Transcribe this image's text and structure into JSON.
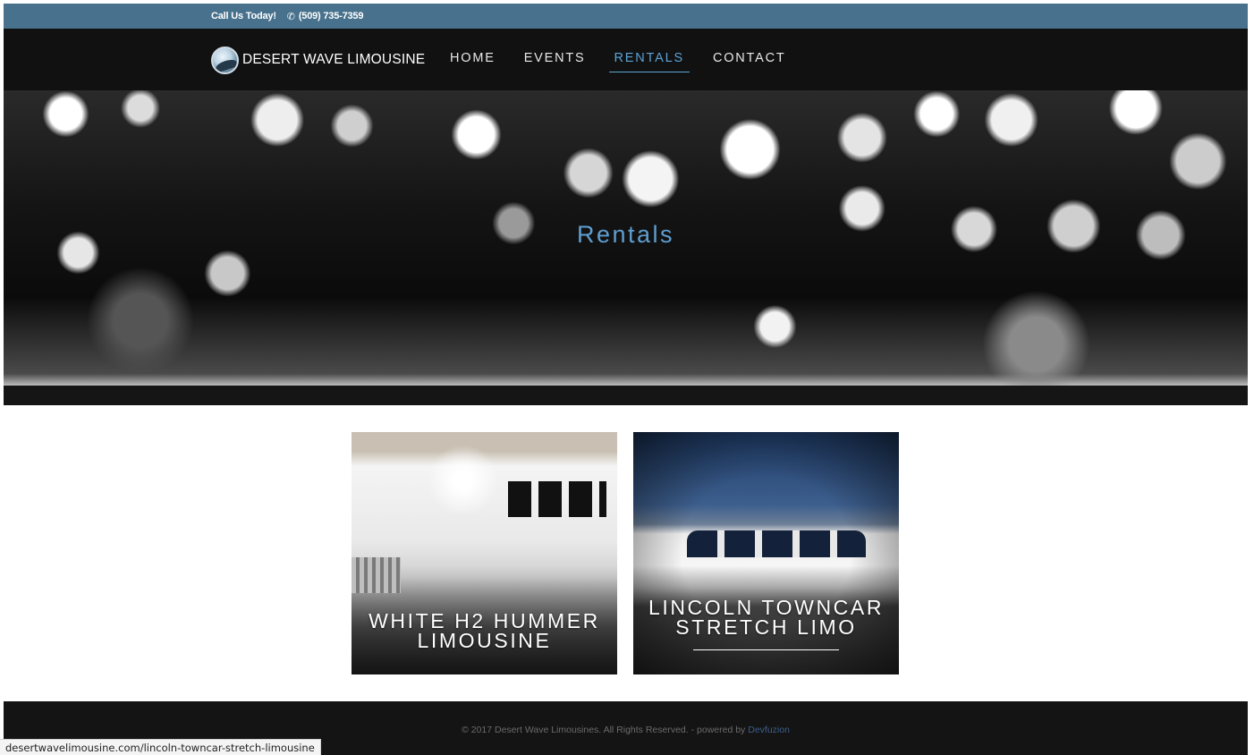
{
  "topbar": {
    "call_label": "Call Us Today!",
    "phone_icon": "✆",
    "phone": "(509) 735-7359"
  },
  "brand": {
    "name": "DESERT WAVE LIMOUSINE"
  },
  "nav": {
    "items": [
      {
        "label": "HOME"
      },
      {
        "label": "EVENTS"
      },
      {
        "label": "RENTALS"
      },
      {
        "label": "CONTACT"
      }
    ],
    "active": "RENTALS"
  },
  "hero": {
    "title": "Rentals"
  },
  "cards": [
    {
      "title": "WHITE H2 HUMMER LIMOUSINE"
    },
    {
      "title": "LINCOLN TOWNCAR STRETCH LIMO"
    }
  ],
  "footer": {
    "text": "© 2017 Desert Wave Limousines. All Rights Reserved. - powered by ",
    "link": "Devfuzion"
  },
  "statusbar": {
    "url": "desertwavelimousine.com/lincoln-towncar-stretch-limousine"
  },
  "colors": {
    "topbar": "#47718c",
    "nav_bg": "#111111",
    "accent": "#5aa3d6"
  }
}
